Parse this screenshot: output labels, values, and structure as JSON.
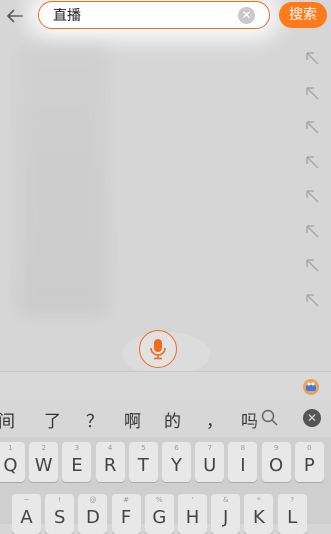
{
  "search": {
    "value": "直播",
    "button_label": "搜索"
  },
  "suggestions": {
    "count": 8
  },
  "candidates": [
    "间",
    "了",
    "？",
    "啊",
    "的",
    "，",
    "吗"
  ],
  "keyboard": {
    "row1": [
      {
        "sub": "1",
        "main": "Q"
      },
      {
        "sub": "2",
        "main": "W"
      },
      {
        "sub": "3",
        "main": "E"
      },
      {
        "sub": "4",
        "main": "R"
      },
      {
        "sub": "5",
        "main": "T"
      },
      {
        "sub": "6",
        "main": "Y"
      },
      {
        "sub": "7",
        "main": "U"
      },
      {
        "sub": "8",
        "main": "I"
      },
      {
        "sub": "9",
        "main": "O"
      },
      {
        "sub": "0",
        "main": "P"
      }
    ],
    "row2": [
      {
        "sub": "~",
        "main": "A"
      },
      {
        "sub": "!",
        "main": "S"
      },
      {
        "sub": "@",
        "main": "D"
      },
      {
        "sub": "#",
        "main": "F"
      },
      {
        "sub": "%",
        "main": "G"
      },
      {
        "sub": "'",
        "main": "H"
      },
      {
        "sub": "&",
        "main": "J"
      },
      {
        "sub": "*",
        "main": "K"
      },
      {
        "sub": "?",
        "main": "L"
      }
    ]
  },
  "colors": {
    "accent": "#ff7a1a",
    "overlay": "#d6d6d6"
  }
}
